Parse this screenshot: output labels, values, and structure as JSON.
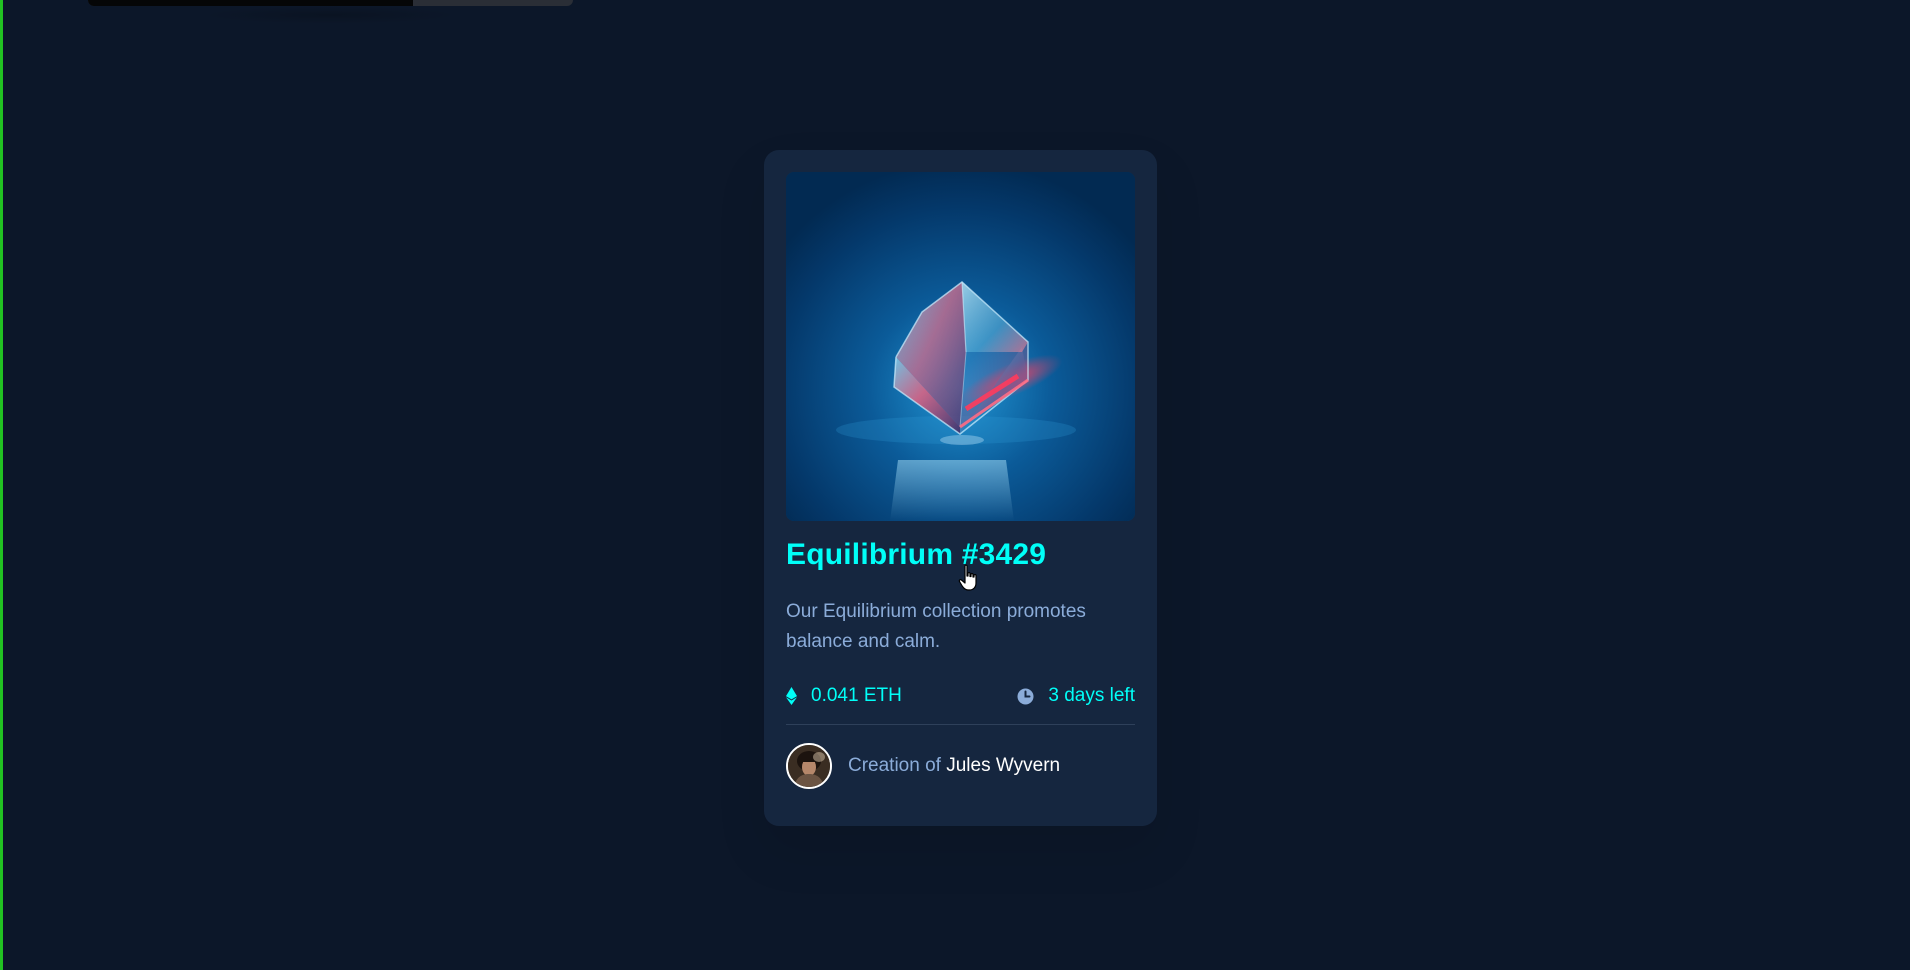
{
  "page": {
    "background_color": "#0c1729",
    "accent_color": "#00fff8",
    "muted_text_color": "#8bacd9",
    "top_strip": {
      "progress_percent": 67
    }
  },
  "card": {
    "background_color": "#15263f",
    "image": {
      "alt": "Equilibrium",
      "subject": "glass-cube"
    },
    "title": "Equilibrium #3429",
    "description": "Our Equilibrium collection promotes balance and calm.",
    "price": {
      "icon": "ethereum-icon",
      "value": "0.041 ETH"
    },
    "time_left": {
      "icon": "clock-icon",
      "value": "3 days left"
    },
    "creator": {
      "avatar_alt": "Jules Wyvern avatar",
      "prefix": "Creation of",
      "name": "Jules Wyvern"
    }
  }
}
